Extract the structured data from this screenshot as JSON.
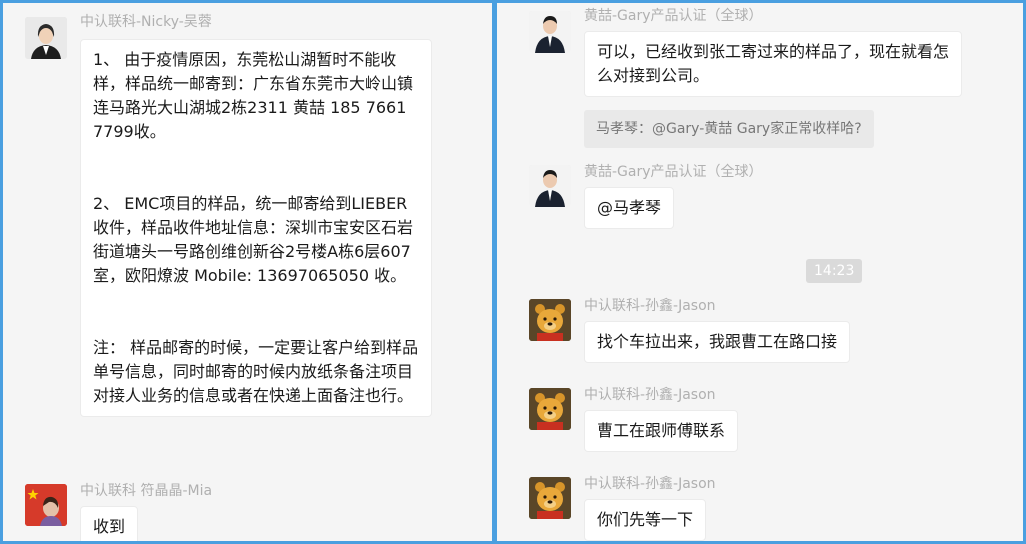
{
  "left": {
    "messages": [
      {
        "sender": "中认联科-Nicky-吴蓉",
        "paragraphs": [
          "1、 由于疫情原因，东莞松山湖暂时不能收样，样品统一邮寄到：广东省东莞市大岭山镇连马路光大山湖城2栋2311 黄喆 185 7661 7799收。",
          "2、 EMC项目的样品，统一邮寄给到LIEBER收件，样品收件地址信息：深圳市宝安区石岩街道塘头一号路创维创新谷2号楼A栋6层607室，欧阳燎波 Mobile: 13697065050 收。",
          "注： 样品邮寄的时候，一定要让客户给到样品单号信息，同时邮寄的时候内放纸条备注项目对接人业务的信息或者在快递上面备注也行。"
        ]
      },
      {
        "sender": "中认联科 符晶晶-Mia",
        "text": "收到"
      }
    ]
  },
  "right": {
    "messages": [
      {
        "sender": "黄喆-Gary产品认证（全球）",
        "text": "可以，已经收到张工寄过来的样品了，现在就看怎么对接到公司。",
        "quote": "马孝琴：@Gary-黄喆 Gary家正常收样哈?"
      },
      {
        "sender": "黄喆-Gary产品认证（全球）",
        "text": "@马孝琴"
      },
      {
        "sender": "中认联科-孙鑫-Jason",
        "text": "找个车拉出来，我跟曹工在路口接"
      },
      {
        "sender": "中认联科-孙鑫-Jason",
        "text": "曹工在跟师傅联系"
      },
      {
        "sender": "中认联科-孙鑫-Jason",
        "text": "你们先等一下"
      }
    ],
    "timestamp": "14:23"
  },
  "colors": {
    "frame": "#4a9fe0",
    "panel_bg": "#f5f5f5",
    "bubble_bg": "#ffffff",
    "sender_text": "#b0b0b0"
  }
}
